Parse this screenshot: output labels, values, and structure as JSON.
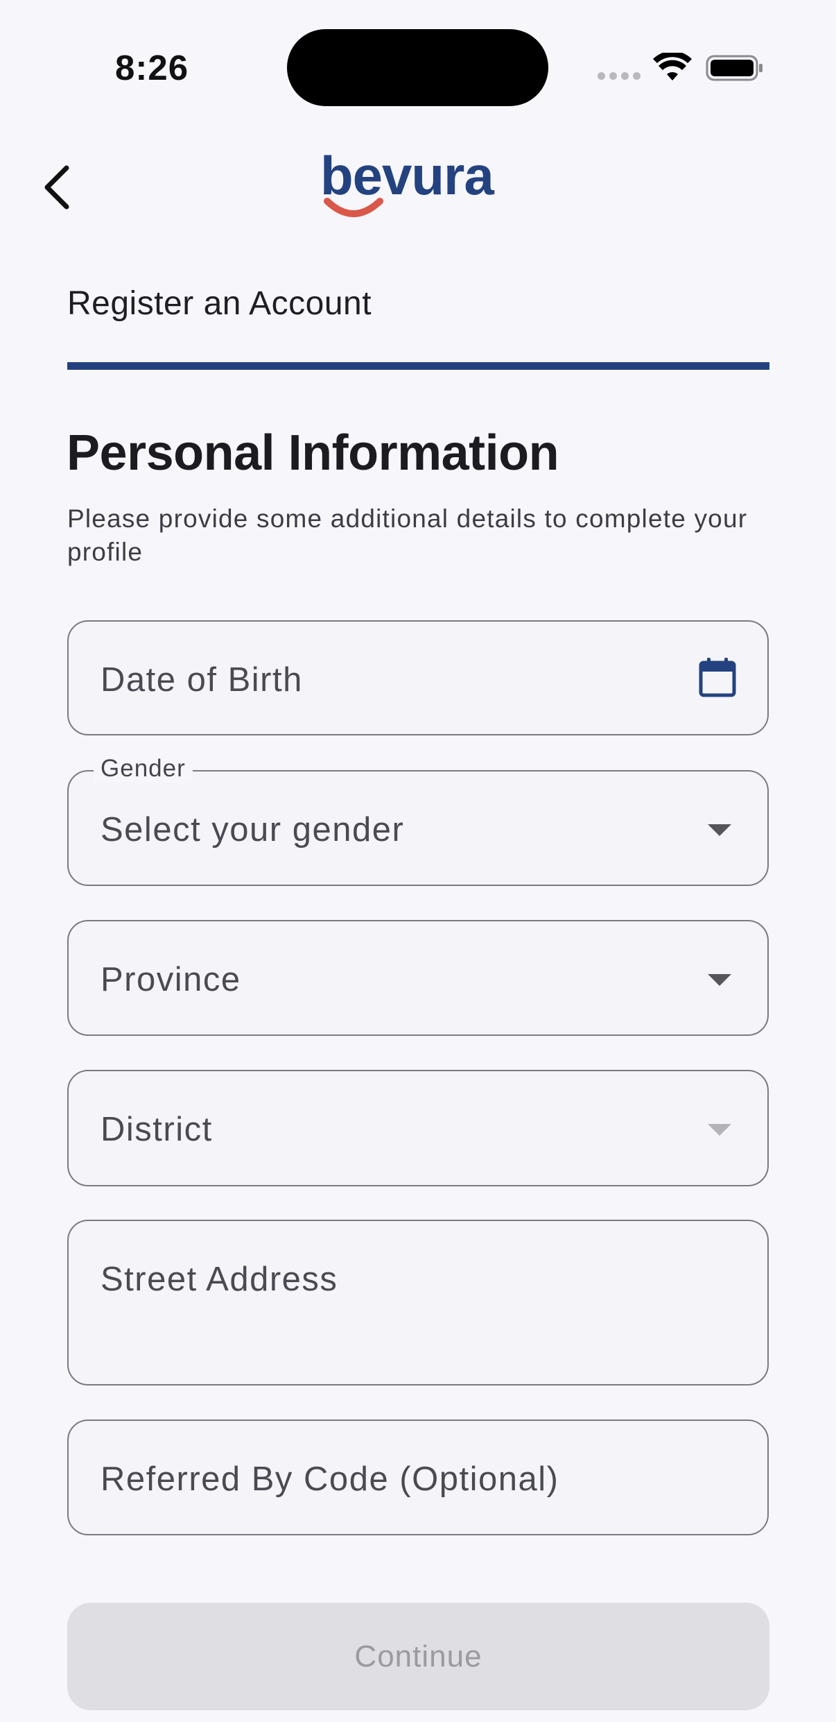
{
  "status_bar": {
    "time": "8:26",
    "icons": [
      "cellular-dots-icon",
      "wifi-icon",
      "battery-icon"
    ]
  },
  "header": {
    "back_icon": "chevron-left-icon",
    "logo_text": "bevura",
    "colors": {
      "brand_blue": "#23427f",
      "brand_red": "#d9584a"
    }
  },
  "registration": {
    "title": "Register an Account",
    "progress_color": "#23427f"
  },
  "section": {
    "title": "Personal Information",
    "subtitle": "Please provide some additional details to complete your profile"
  },
  "form": {
    "date_of_birth": {
      "placeholder": "Date of Birth",
      "icon": "calendar-icon"
    },
    "gender": {
      "label": "Gender",
      "placeholder": "Select your gender",
      "icon": "dropdown-arrow-icon"
    },
    "province": {
      "placeholder": "Province",
      "icon": "dropdown-arrow-icon"
    },
    "district": {
      "placeholder": "District",
      "icon": "dropdown-arrow-icon",
      "disabled": true
    },
    "street_address": {
      "placeholder": "Street Address"
    },
    "referral_code": {
      "placeholder": "Referred By Code (Optional)"
    }
  },
  "actions": {
    "continue_label": "Continue",
    "continue_disabled": true
  }
}
